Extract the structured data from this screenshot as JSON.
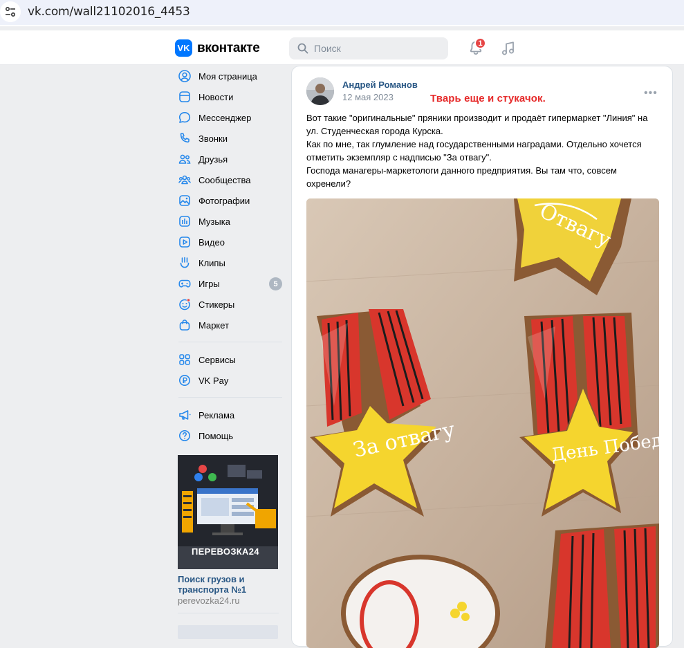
{
  "browser": {
    "url": "vk.com/wall21102016_4453"
  },
  "header": {
    "logo_text": "вконтакте",
    "logo_mark": "VK",
    "search_placeholder": "Поиск",
    "notifications_count": "1",
    "icons": [
      "search-icon",
      "bell-icon",
      "music-icon"
    ],
    "accent": "#0077ff"
  },
  "sidebar": {
    "items": [
      {
        "label": "Моя страница",
        "icon": "user-circle-icon"
      },
      {
        "label": "Новости",
        "icon": "news-icon"
      },
      {
        "label": "Мессенджер",
        "icon": "message-icon"
      },
      {
        "label": "Звонки",
        "icon": "phone-icon"
      },
      {
        "label": "Друзья",
        "icon": "friends-icon"
      },
      {
        "label": "Сообщества",
        "icon": "communities-icon"
      },
      {
        "label": "Фотографии",
        "icon": "photo-icon"
      },
      {
        "label": "Музыка",
        "icon": "music-icon"
      },
      {
        "label": "Видео",
        "icon": "video-icon"
      },
      {
        "label": "Клипы",
        "icon": "clips-icon"
      },
      {
        "label": "Игры",
        "icon": "gamepad-icon",
        "badge": "5"
      },
      {
        "label": "Стикеры",
        "icon": "sticker-icon"
      },
      {
        "label": "Маркет",
        "icon": "market-icon"
      }
    ],
    "items2": [
      {
        "label": "Сервисы",
        "icon": "services-icon"
      },
      {
        "label": "VK Pay",
        "icon": "vkpay-icon"
      }
    ],
    "items3": [
      {
        "label": "Реклама",
        "icon": "megaphone-icon"
      },
      {
        "label": "Помощь",
        "icon": "help-icon"
      }
    ],
    "ad": {
      "title": "Поиск грузов и транспорта №1",
      "domain": "perevozka24.ru",
      "image_brand": "ПЕРЕВОЗКА24"
    }
  },
  "post": {
    "author": "Андрей Романов",
    "date": "12 мая 2023",
    "overlay_note": "Тварь еще и стукачок.",
    "more": "•••",
    "text_lines": [
      "Вот такие \"оригинальные\" пряники производит и продаёт гипермаркет \"Линия\" на",
      "ул. Студенческая города Курска.",
      "Как по мне, так глумление над государственными наградами. Отдельно хочется",
      "отметить экземпляр с надписью \"За отвагу\".",
      "Господа манагеры-маркетологи данного предприятия. Вы там что, совсем",
      "охренели?"
    ],
    "photo_inscriptions": [
      "Отвагу",
      "За отвагу",
      "День Победы"
    ]
  }
}
